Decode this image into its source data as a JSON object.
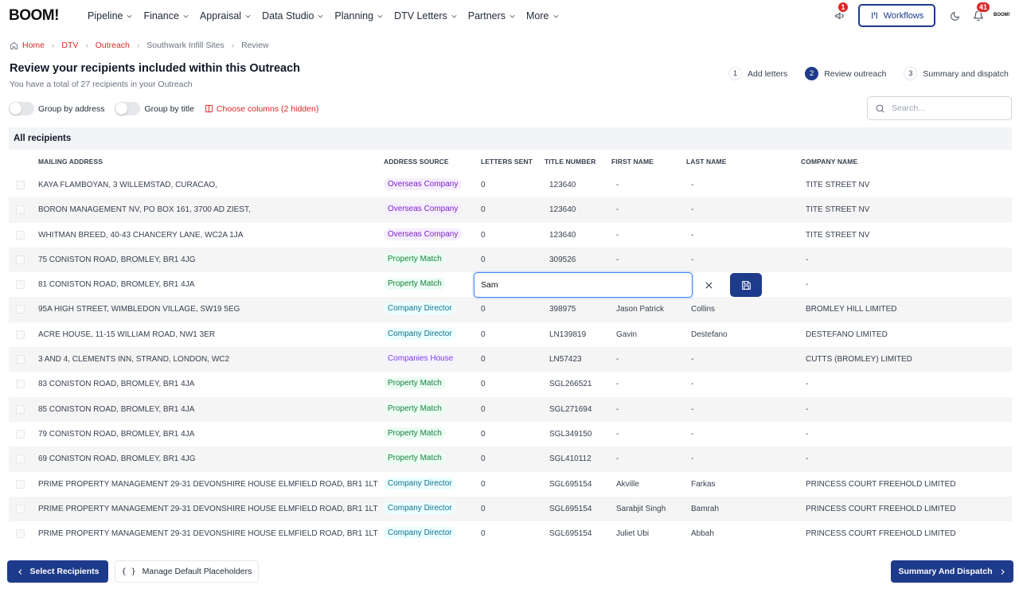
{
  "app": {
    "logo": "BOOM!",
    "brand_small": "BOOM!"
  },
  "nav": {
    "items": [
      {
        "label": "Pipeline"
      },
      {
        "label": "Finance"
      },
      {
        "label": "Appraisal"
      },
      {
        "label": "Data Studio"
      },
      {
        "label": "Planning"
      },
      {
        "label": "DTV Letters"
      },
      {
        "label": "Partners"
      },
      {
        "label": "More"
      }
    ],
    "announcements_badge": "1",
    "workflows_label": "Workflows",
    "notifications_badge": "41",
    "icons": [
      "megaphone-icon",
      "workflow-icon",
      "moon-icon",
      "bell-icon"
    ]
  },
  "breadcrumb": [
    "Home",
    "DTV",
    "Outreach",
    "Southwark Infill Sites",
    "Review"
  ],
  "page": {
    "title": "Review your recipients included within this Outreach",
    "subtitle": "You have a total of 27 recipients in your Outreach"
  },
  "steps": [
    {
      "num": "1",
      "label": "Add letters"
    },
    {
      "num": "2",
      "label": "Review outreach"
    },
    {
      "num": "3",
      "label": "Summary and dispatch"
    }
  ],
  "controls": {
    "group_by_address": "Group by address",
    "group_by_title": "Group by title",
    "choose_columns": "Choose columns (2 hidden)",
    "search_placeholder": "Search..."
  },
  "table": {
    "header": "All recipients",
    "columns": [
      "MAILING ADDRESS",
      "ADDRESS SOURCE",
      "LETTERS SENT",
      "TITLE NUMBER",
      "FIRST NAME",
      "LAST NAME",
      "COMPANY NAME"
    ],
    "rows": [
      {
        "address": "KAYA FLAMBOYAN, 3 WILLEMSTAD, CURACAO,",
        "source": "Overseas Company",
        "sent": "0",
        "title": "123640",
        "first": "-",
        "last": "-",
        "company": "TITE STREET NV"
      },
      {
        "address": "BORON MANAGEMENT NV, PO BOX 161, 3700 AD ZIEST,",
        "source": "Overseas Company",
        "sent": "0",
        "title": "123640",
        "first": "-",
        "last": "-",
        "company": "TITE STREET NV"
      },
      {
        "address": "WHITMAN BREED, 40-43 CHANCERY LANE, WC2A 1JA",
        "source": "Overseas Company",
        "sent": "0",
        "title": "123640",
        "first": "-",
        "last": "-",
        "company": "TITE STREET NV"
      },
      {
        "address": "75 CONISTON ROAD, BROMLEY, BR1 4JG",
        "source": "Property Match",
        "sent": "0",
        "title": "309526",
        "first": "-",
        "last": "-",
        "company": "-"
      },
      {
        "address": "81 CONISTON ROAD, BROMLEY, BR1 4JA",
        "source": "Property Match",
        "sent": "",
        "title": "",
        "first": "",
        "last": "",
        "company": "-"
      },
      {
        "address": "95A HIGH STREET, WIMBLEDON VILLAGE, SW19 5EG",
        "source": "Company Director",
        "sent": "0",
        "title": "398975",
        "first": "Jason Patrick",
        "last": "Collins",
        "company": "BROMLEY HILL LIMITED"
      },
      {
        "address": "ACRE HOUSE, 11-15 WILLIAM ROAD, NW1 3ER",
        "source": "Company Director",
        "sent": "0",
        "title": "LN139819",
        "first": "Gavin",
        "last": "Destefano",
        "company": "DESTEFANO LIMITED"
      },
      {
        "address": "3 AND 4, CLEMENTS INN, STRAND, LONDON, WC2",
        "source": "Companies House",
        "sent": "0",
        "title": "LN57423",
        "first": "-",
        "last": "-",
        "company": "CUTTS (BROMLEY) LIMITED"
      },
      {
        "address": "83 CONISTON ROAD, BROMLEY, BR1 4JA",
        "source": "Property Match",
        "sent": "0",
        "title": "SGL266521",
        "first": "-",
        "last": "-",
        "company": "-"
      },
      {
        "address": "85 CONISTON ROAD, BROMLEY, BR1 4JA",
        "source": "Property Match",
        "sent": "0",
        "title": "SGL271694",
        "first": "-",
        "last": "-",
        "company": "-"
      },
      {
        "address": "79 CONISTON ROAD, BROMLEY, BR1 4JA",
        "source": "Property Match",
        "sent": "0",
        "title": "SGL349150",
        "first": "-",
        "last": "-",
        "company": "-"
      },
      {
        "address": "69 CONISTON ROAD, BROMLEY, BR1 4JG",
        "source": "Property Match",
        "sent": "0",
        "title": "SGL410112",
        "first": "-",
        "last": "-",
        "company": "-"
      },
      {
        "address": "PRIME PROPERTY MANAGEMENT 29-31 DEVONSHIRE HOUSE ELMFIELD ROAD, BR1 1LT",
        "source": "Company Director",
        "sent": "0",
        "title": "SGL695154",
        "first": "Akville",
        "last": "Farkas",
        "company": "PRINCESS COURT FREEHOLD LIMITED"
      },
      {
        "address": "PRIME PROPERTY MANAGEMENT 29-31 DEVONSHIRE HOUSE ELMFIELD ROAD, BR1 1LT",
        "source": "Company Director",
        "sent": "0",
        "title": "SGL695154",
        "first": "Sarabjit Singh",
        "last": "Bamrah",
        "company": "PRINCESS COURT FREEHOLD LIMITED"
      },
      {
        "address": "PRIME PROPERTY MANAGEMENT 29-31 DEVONSHIRE HOUSE ELMFIELD ROAD, BR1 1LT",
        "source": "Company Director",
        "sent": "0",
        "title": "SGL695154",
        "first": "Juliet Ubi",
        "last": "Abbah",
        "company": "PRINCESS COURT FREEHOLD LIMITED"
      }
    ]
  },
  "editor": {
    "value": "Sam"
  },
  "footer": {
    "select_recipients": "Select Recipients",
    "manage_placeholders": "Manage Default Placeholders",
    "summary_dispatch": "Summary And Dispatch"
  },
  "colors": {
    "primary": "#1e3a8a",
    "accent_red": "#dc2626"
  }
}
